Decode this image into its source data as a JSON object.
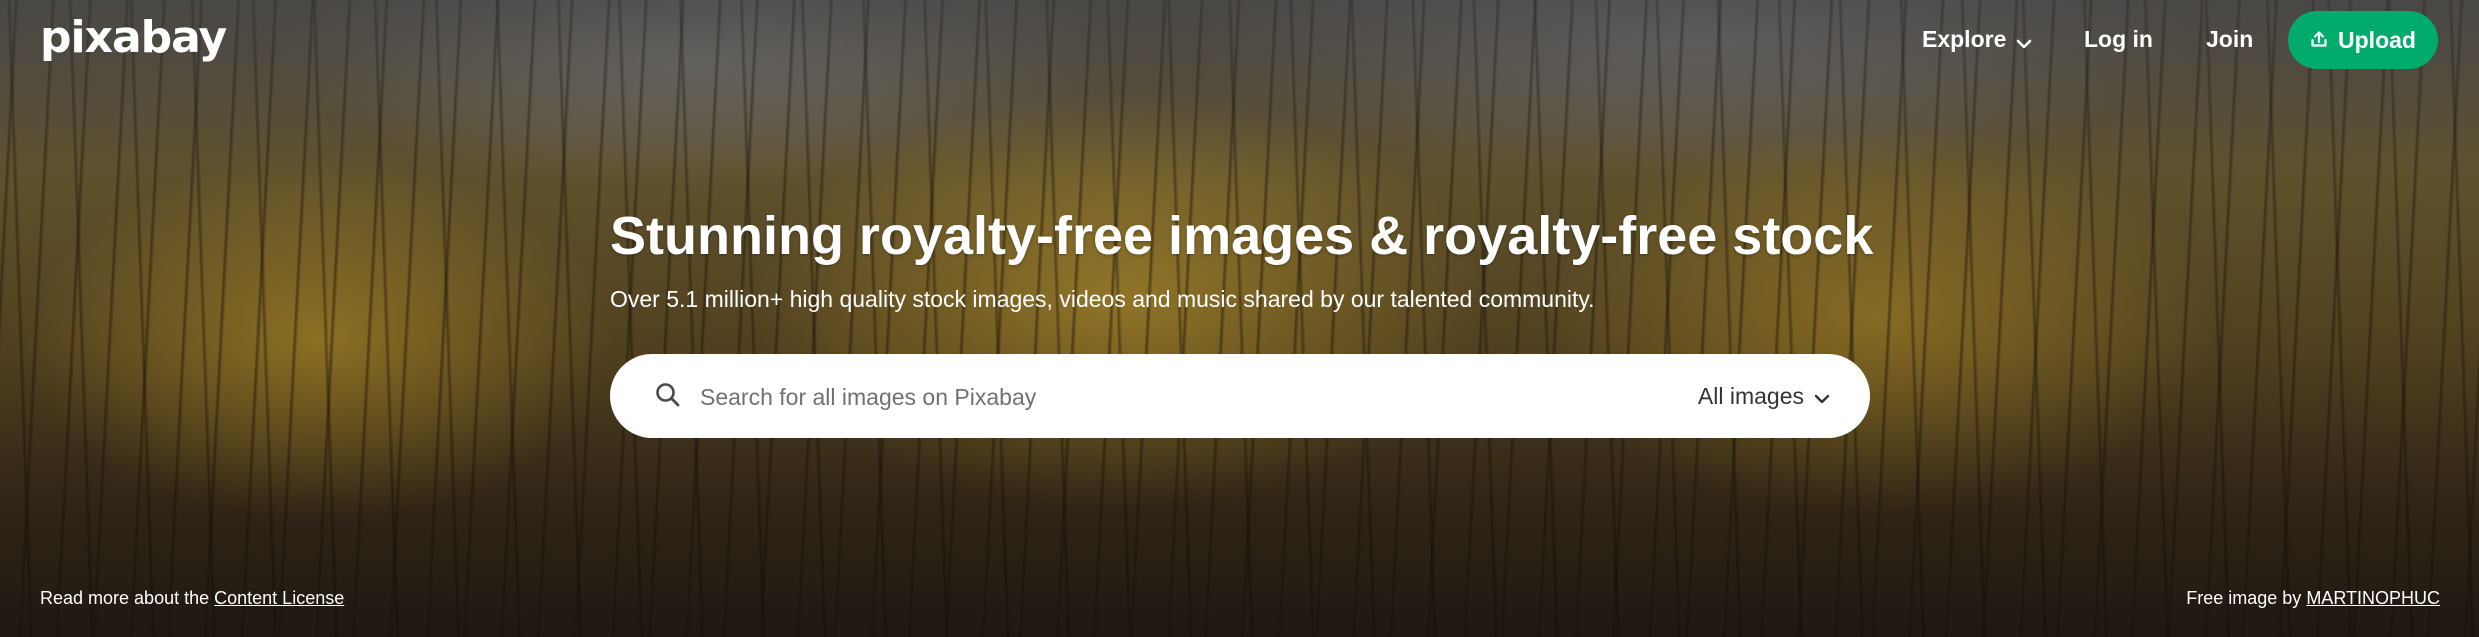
{
  "brand": {
    "logo_text": "pixabay"
  },
  "nav": {
    "explore_label": "Explore",
    "login_label": "Log in",
    "join_label": "Join",
    "upload_label": "Upload"
  },
  "hero": {
    "headline": "Stunning royalty-free images & royalty-free stock",
    "subline": "Over 5.1 million+ high quality stock images, videos and music shared by our talented community."
  },
  "search": {
    "placeholder": "Search for all images on Pixabay",
    "value": "",
    "filter_label": "All images"
  },
  "footer": {
    "license_prefix": "Read more about the",
    "license_link": "Content License",
    "credit_prefix": "Free image by",
    "credit_link": "MARTINOPHUC"
  },
  "colors": {
    "accent": "#00ab6b",
    "text_on_dark": "#ffffff",
    "search_bg": "#ffffff"
  },
  "icons": {
    "explore_chevron": "chevron-down-icon",
    "upload": "upload-icon",
    "search": "search-icon",
    "filter_chevron": "chevron-down-icon"
  }
}
